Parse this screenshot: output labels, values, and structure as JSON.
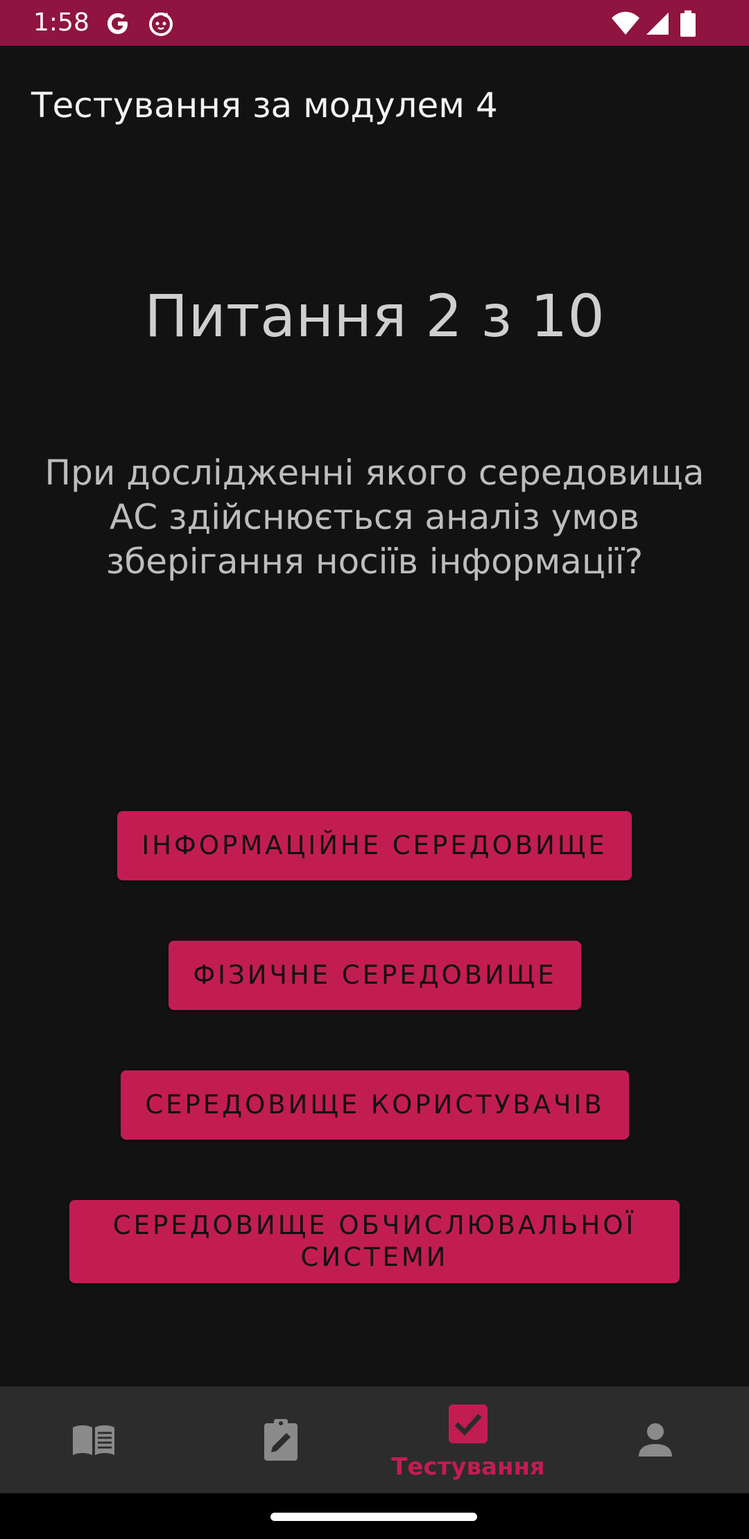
{
  "status_bar": {
    "time": "1:58",
    "background": "#8f1440",
    "icons": [
      "google-icon",
      "cat-notification-icon",
      "wifi-icon",
      "signal-icon",
      "battery-icon"
    ]
  },
  "header": {
    "title": "Тестування за модулем 4"
  },
  "quiz": {
    "counter": "Питання 2 з 10",
    "question": "При дослідженні якого середовища АС здійснюється аналіз умов зберігання носіїв інформації?",
    "answers": [
      {
        "label": "ІНФОРМАЦІЙНЕ СЕРЕДОВИЩЕ"
      },
      {
        "label": "ФІЗИЧНЕ СЕРЕДОВИЩЕ"
      },
      {
        "label": "СЕРЕДОВИЩЕ КОРИСТУВАЧІВ"
      },
      {
        "label": "СЕРЕДОВИЩЕ ОБЧИСЛЮВАЛЬНОЇ СИСТЕМИ"
      }
    ],
    "button_color": "#c21d52"
  },
  "bottom_nav": {
    "items": [
      {
        "icon": "book-icon",
        "label": ""
      },
      {
        "icon": "clipboard-edit-icon",
        "label": ""
      },
      {
        "icon": "checkbox-icon",
        "label": "Тестування",
        "active": true
      },
      {
        "icon": "person-icon",
        "label": ""
      }
    ],
    "active_color": "#c21d52",
    "inactive_color": "#8a8a8a"
  }
}
